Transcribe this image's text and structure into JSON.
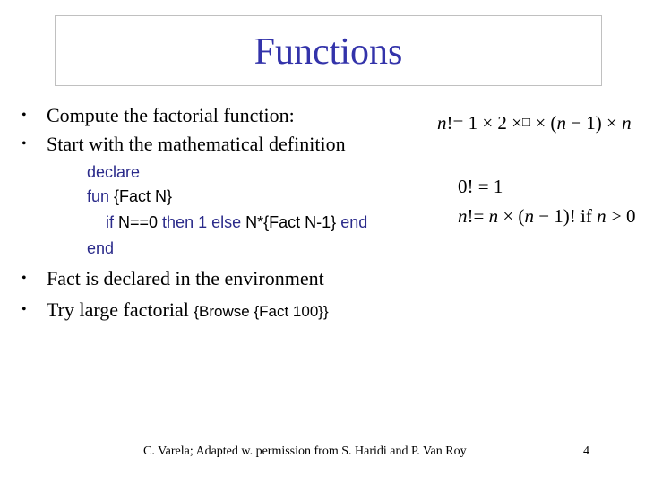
{
  "slide": {
    "title": "Functions",
    "bullets": [
      {
        "text": "Compute the factorial function:"
      },
      {
        "text": "Start with the mathematical definition"
      },
      {
        "text": "Fact is declared in the environment"
      },
      {
        "text": "Try large factorial ",
        "code": "{Browse {Fact 100}}"
      }
    ],
    "bullet_glyph": "•",
    "code_block": {
      "line1": {
        "kw": "declare"
      },
      "line2": {
        "kw": "fun",
        "rest": " {Fact N}"
      },
      "line3": {
        "kw_if": "if",
        "cond": " N==0 ",
        "kw_then": "then",
        "val1": " 1 ",
        "kw_else": "else",
        "expr": " N*{Fact N-1} ",
        "kw_end": "end"
      },
      "line4": {
        "kw": "end"
      }
    },
    "math": {
      "product_def": {
        "lhs": "n",
        "eq": "!= 1 × 2 ×",
        "missing_glyph": "□",
        "rest_a": "  × (",
        "n1": "n",
        "rest_b": " − 1) × ",
        "n2": "n"
      },
      "base_case": "0! = 1",
      "recursive_case": {
        "lhs": "n",
        "eq": "!= ",
        "n1": "n",
        "mid": " × (",
        "n2": "n",
        "mid2": " − 1)! if ",
        "n3": "n",
        "tail": " > 0"
      }
    },
    "footer": {
      "credit": "C. Varela;  Adapted w. permission from S. Haridi and P. Van Roy",
      "page_number": "4"
    },
    "colors": {
      "title": "#3333aa",
      "keyword": "#2a2a8a",
      "border": "#c0c0c0"
    }
  }
}
